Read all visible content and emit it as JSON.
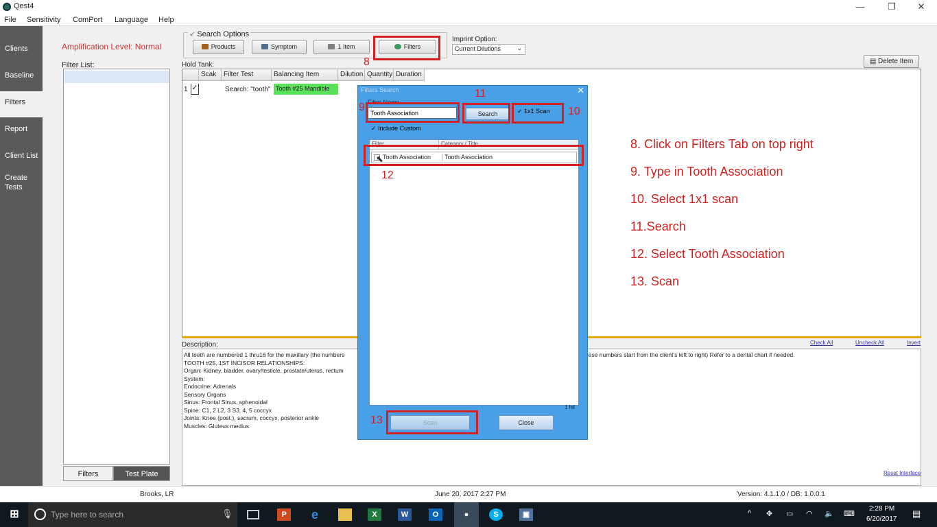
{
  "window": {
    "title": "Qest4",
    "minimize": "—",
    "maximize": "❐",
    "close": "✕"
  },
  "menu": [
    "File",
    "Sensitivity",
    "ComPort",
    "Language",
    "Help"
  ],
  "nav": [
    "Clients",
    "Baseline",
    "Filters",
    "Report",
    "Client List",
    "Create Tests"
  ],
  "amplification": "Amplification Level: Normal",
  "filter_list": {
    "label": "Filter List:",
    "tabs": [
      "Filters",
      "Test Plate"
    ]
  },
  "search_options": {
    "legend": "Search Options",
    "buttons": [
      "Products",
      "Symptom",
      "1 Item",
      "Filters"
    ]
  },
  "imprint": {
    "label": "Imprint Option:",
    "value": "Current Dilutions"
  },
  "delete_item": "Delete Item",
  "hold_tank": {
    "label": "Hold Tank:",
    "columns": [
      "Scak",
      "Filter Test",
      "Balancing Item",
      "Dilution",
      "Quantity",
      "Duration"
    ],
    "row": {
      "num": "1",
      "check": "✓",
      "filter": "Search: \"tooth\"",
      "balancing": "Tooth #25 Mandible"
    }
  },
  "description": {
    "label": "Description:",
    "links": [
      "Check All",
      "Uncheck All",
      "Invert"
    ],
    "lines": [
      "All teeth are numbered 1 thru16 for the maxillary (the numbers",
      "TOOTH #25, 1ST INCISOR RELATIONSHIPS:",
      "Organ: Kidney, bladder, ovary/testicle, prostate/uterus, rectum",
      "System:",
      "Endocrine: Adrenals",
      "Sensory Organs",
      "Sinus: Frontal Sinus, sphenoidal",
      "Spine: C1, 2    L2, 3    S3, 4, 5   coccyx",
      "Joints: Knee (post.), sacrum, coccyx, posterior ankle",
      "Muscles: Gluteus medius"
    ],
    "right_text": "hese numbers start from the client's left to right)   Refer to a dental chart if needed.",
    "reset": "Reset Interface"
  },
  "dialog": {
    "title": "Filters Search",
    "filter_name_label": "Filter Name",
    "filter_name_value": "Tooth Association",
    "search": "Search",
    "scan_1x1": "✓ 1x1 Scan",
    "include_custom": "✓ Include Custom",
    "columns": [
      "Filter",
      "Category / Title"
    ],
    "row": [
      "Tooth Association",
      "Tooth Association"
    ],
    "hits": "1 hit",
    "scan": "Scan",
    "close": "Close"
  },
  "annotations": {
    "numbers": [
      "8",
      "9",
      "10",
      "11",
      "12",
      "13"
    ],
    "steps": [
      "8. Click on Filters Tab on top right",
      "9. Type in Tooth Association",
      "10. Select 1x1 scan",
      "11.Search",
      "12. Select Tooth Association",
      "13. Scan"
    ],
    "color": "#d42020"
  },
  "status": {
    "user": "Brooks, LR",
    "datetime": "June 20, 2017  2:27 PM",
    "version": "Version: 4.1.1.0 / DB: 1.0.0.1"
  },
  "taskbar": {
    "search_placeholder": "Type here to search",
    "icons": [
      "windows-start-icon",
      "cortana-icon",
      "microphone-icon",
      "task-view-icon",
      "powerpoint-icon",
      "edge-icon",
      "file-explorer-icon",
      "excel-icon",
      "word-icon",
      "outlook-icon",
      "qest4-app-icon",
      "skype-icon",
      "save-disk-icon"
    ],
    "time": "2:28 PM",
    "date": "6/20/2017"
  }
}
